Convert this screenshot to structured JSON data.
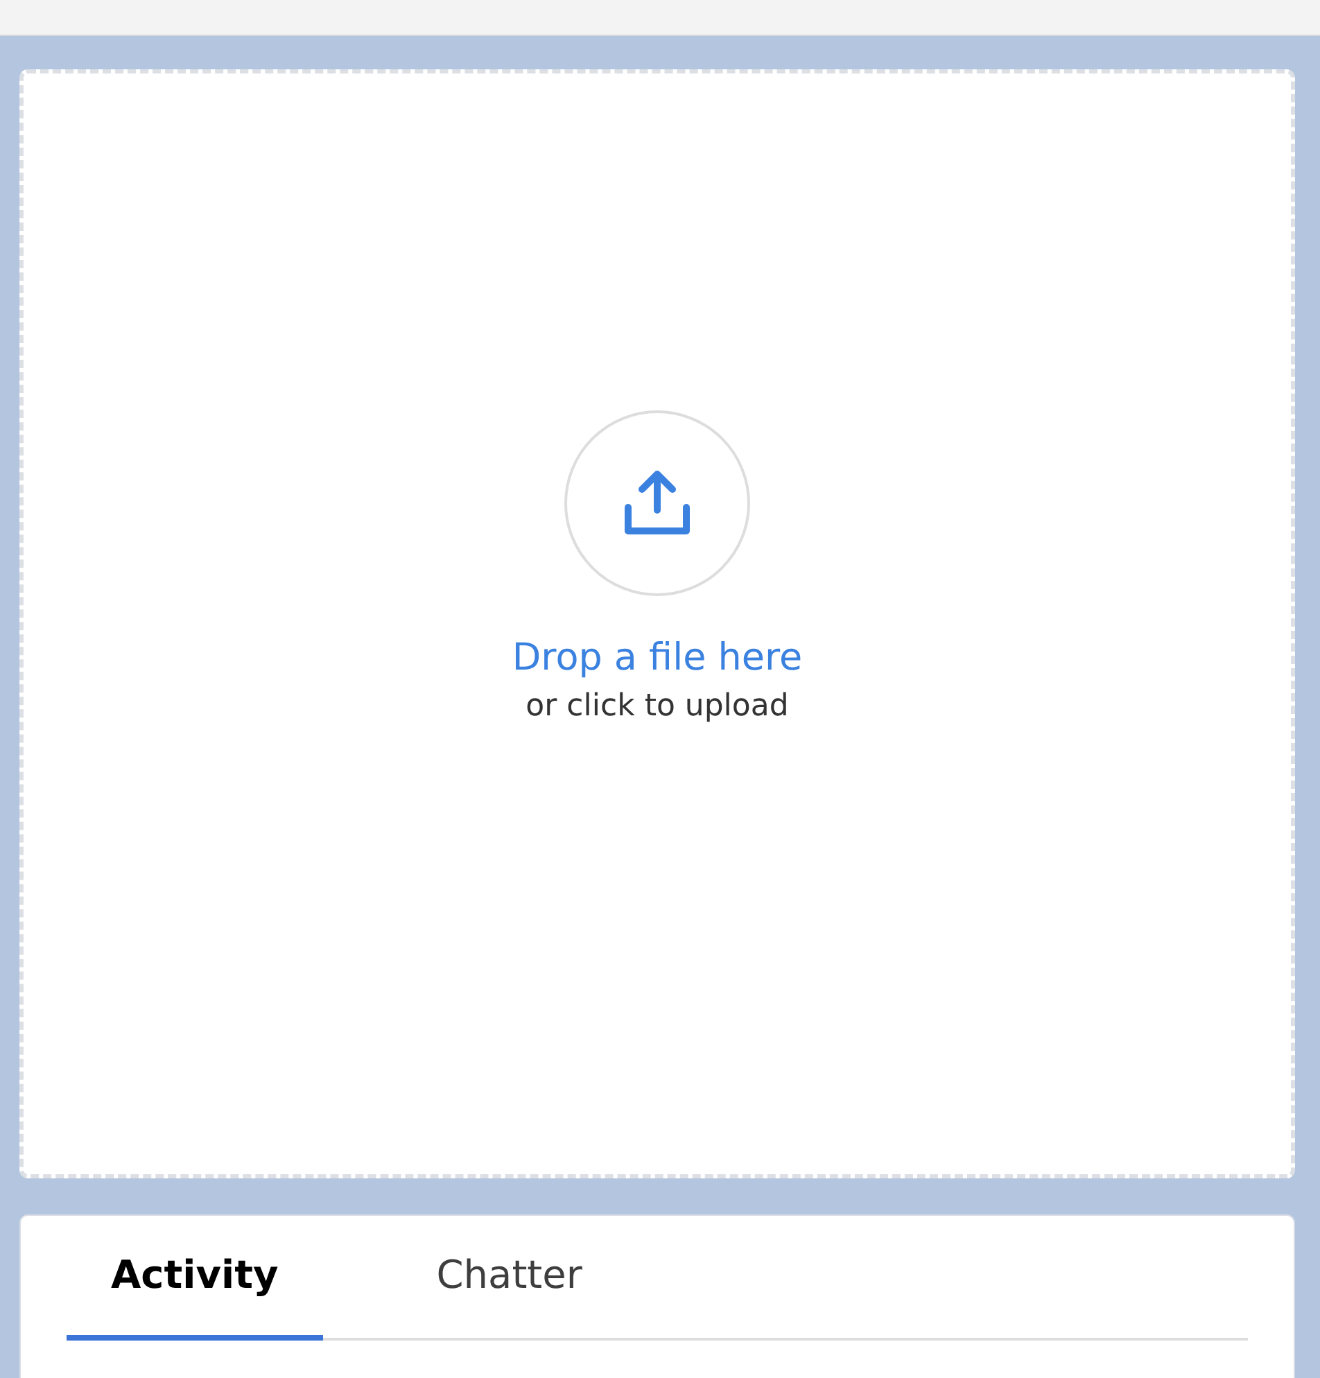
{
  "drop_zone": {
    "title": "Drop a file here",
    "subtitle": "or click to upload"
  },
  "tabs": [
    {
      "label": "Activity",
      "selected": true
    },
    {
      "label": "Chatter",
      "selected": false
    }
  ]
}
